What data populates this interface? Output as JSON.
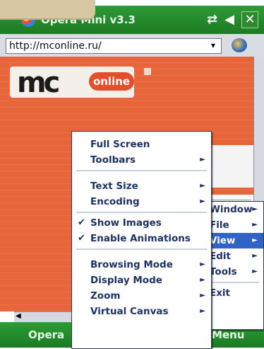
{
  "titlebar": {
    "app_title": "Opera Mini v3.3",
    "status": {
      "signal": "⇄",
      "volume": "◀",
      "close": "✕"
    }
  },
  "address": {
    "url": "http://mconline.ru/",
    "dropdown_glyph": "▾"
  },
  "page": {
    "logo_mc": "mc",
    "logo_online": "online"
  },
  "main_menu": {
    "items": [
      {
        "label": "Full Screen",
        "submenu": false,
        "checked": false
      },
      {
        "label": "Toolbars",
        "submenu": true,
        "checked": false
      },
      {
        "label": "Text Size",
        "submenu": true,
        "checked": false
      },
      {
        "label": "Encoding",
        "submenu": true,
        "checked": false
      },
      {
        "label": "Show Images",
        "submenu": false,
        "checked": true
      },
      {
        "label": "Enable Animations",
        "submenu": false,
        "checked": true
      },
      {
        "label": "Browsing Mode",
        "submenu": true,
        "checked": false
      },
      {
        "label": "Display Mode",
        "submenu": true,
        "checked": false
      },
      {
        "label": "Zoom",
        "submenu": true,
        "checked": false
      },
      {
        "label": "Virtual Canvas",
        "submenu": true,
        "checked": false
      }
    ],
    "check_glyph": "✔",
    "arrow_glyph": "►"
  },
  "back_menu": {
    "items": [
      {
        "label": "Window",
        "selected": false
      },
      {
        "label": "File",
        "selected": false
      },
      {
        "label": "View",
        "selected": true
      },
      {
        "label": "Edit",
        "selected": false
      },
      {
        "label": "Tools",
        "selected": false
      },
      {
        "label": "Exit",
        "selected": false
      }
    ]
  },
  "softkeys": {
    "left": "Opera",
    "right": "Menu"
  },
  "colors": {
    "titlebar": "#2f9a36",
    "menu_text": "#1e3266",
    "selection": "#2f63c6",
    "page_bg": "#e8643a"
  }
}
